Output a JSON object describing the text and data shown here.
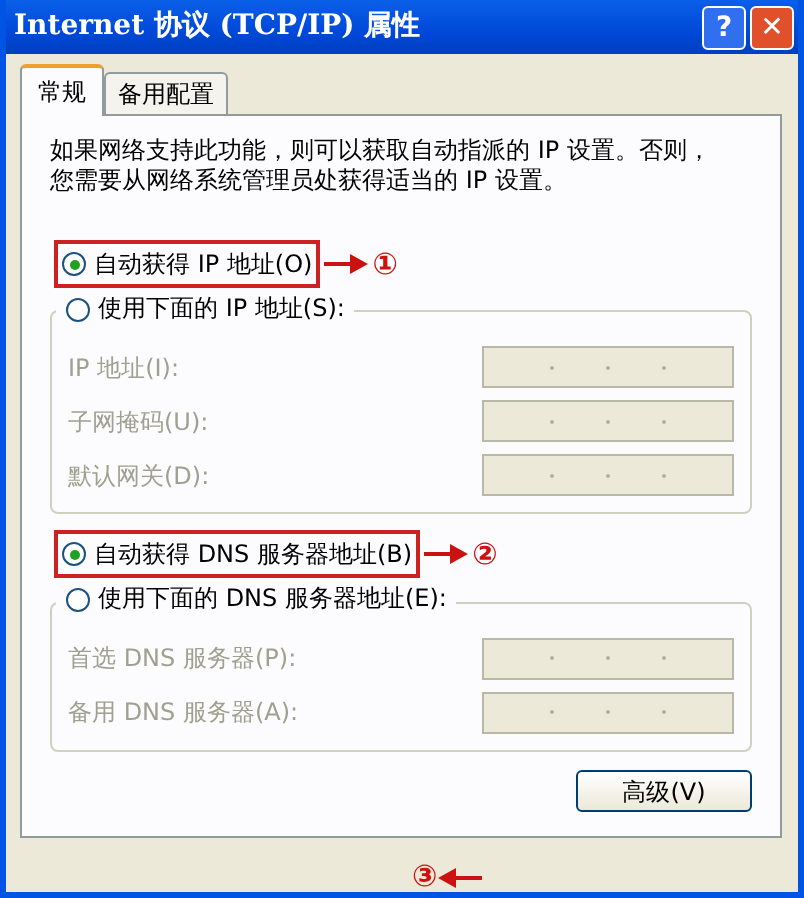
{
  "window": {
    "title": "Internet 协议 (TCP/IP) 属性",
    "buttons": [
      {
        "kind": "help",
        "label": "?"
      },
      {
        "kind": "close",
        "label": "✕"
      }
    ]
  },
  "tabs": [
    {
      "label": "常规",
      "selected": true
    },
    {
      "label": "备用配置",
      "selected": false
    }
  ],
  "description_lines": [
    "如果网络支持此功能，则可以获取自动指派的 IP 设置。否则，",
    "您需要从网络系统管理员处获得适当的 IP 设置。"
  ],
  "sections": [
    {
      "auto_option": {
        "label": "自动获得 IP 地址(O)",
        "selected": true,
        "annotation": "①"
      },
      "manual_option": {
        "label": "使用下面的 IP 地址(S):",
        "selected": false
      },
      "fields": [
        {
          "label": "IP 地址(I):",
          "disabled": true
        },
        {
          "label": "子网掩码(U):",
          "disabled": true
        },
        {
          "label": "默认网关(D):",
          "disabled": true
        }
      ]
    },
    {
      "auto_option": {
        "label": "自动获得 DNS 服务器地址(B)",
        "selected": true,
        "annotation": "②"
      },
      "manual_option": {
        "label": "使用下面的 DNS 服务器地址(E):",
        "selected": false
      },
      "fields": [
        {
          "label": "首选 DNS 服务器(P):",
          "disabled": true
        },
        {
          "label": "备用 DNS 服务器(A):",
          "disabled": true
        }
      ]
    }
  ],
  "advanced_button": "高级(V)",
  "footer_annotation": "③"
}
